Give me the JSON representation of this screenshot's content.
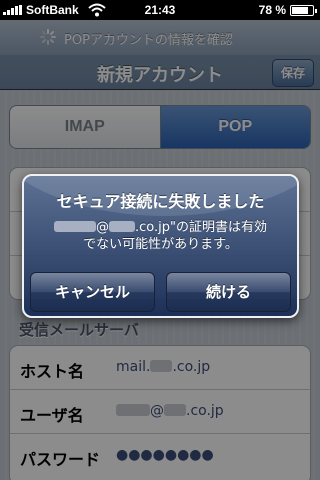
{
  "status_bar": {
    "carrier": "SoftBank",
    "time": "21:43",
    "battery_percent": "78 %",
    "battery_level": 0.78
  },
  "nav_bar": {
    "prompt": "POPアカウントの情報を確認",
    "title": "新規アカウント",
    "save_label": "保存"
  },
  "account_type": {
    "options": [
      "IMAP",
      "POP"
    ],
    "selected": "POP"
  },
  "incoming_server": {
    "header": "受信メールサーバ",
    "rows": [
      {
        "label": "ホスト名",
        "value_prefix": "mail.",
        "value_suffix": ".co.jp"
      },
      {
        "label": "ユーザ名",
        "value_prefix": "",
        "value_suffix": "@",
        "value_end": ".co.jp"
      },
      {
        "label": "パスワード",
        "value": "●●●●●●●●"
      }
    ]
  },
  "alert": {
    "title": "セキュア接続に失敗しました",
    "message_part1": "@",
    "message_part2": ".co.jp\"の証明書は有効",
    "message_line2": "でない可能性があります。",
    "cancel_label": "キャンセル",
    "continue_label": "続ける"
  },
  "colors": {
    "nav_blue": "#6d84a0",
    "segment_selected": "#2c63b5",
    "alert_top": "#5a7094",
    "alert_bottom": "#182c56"
  }
}
